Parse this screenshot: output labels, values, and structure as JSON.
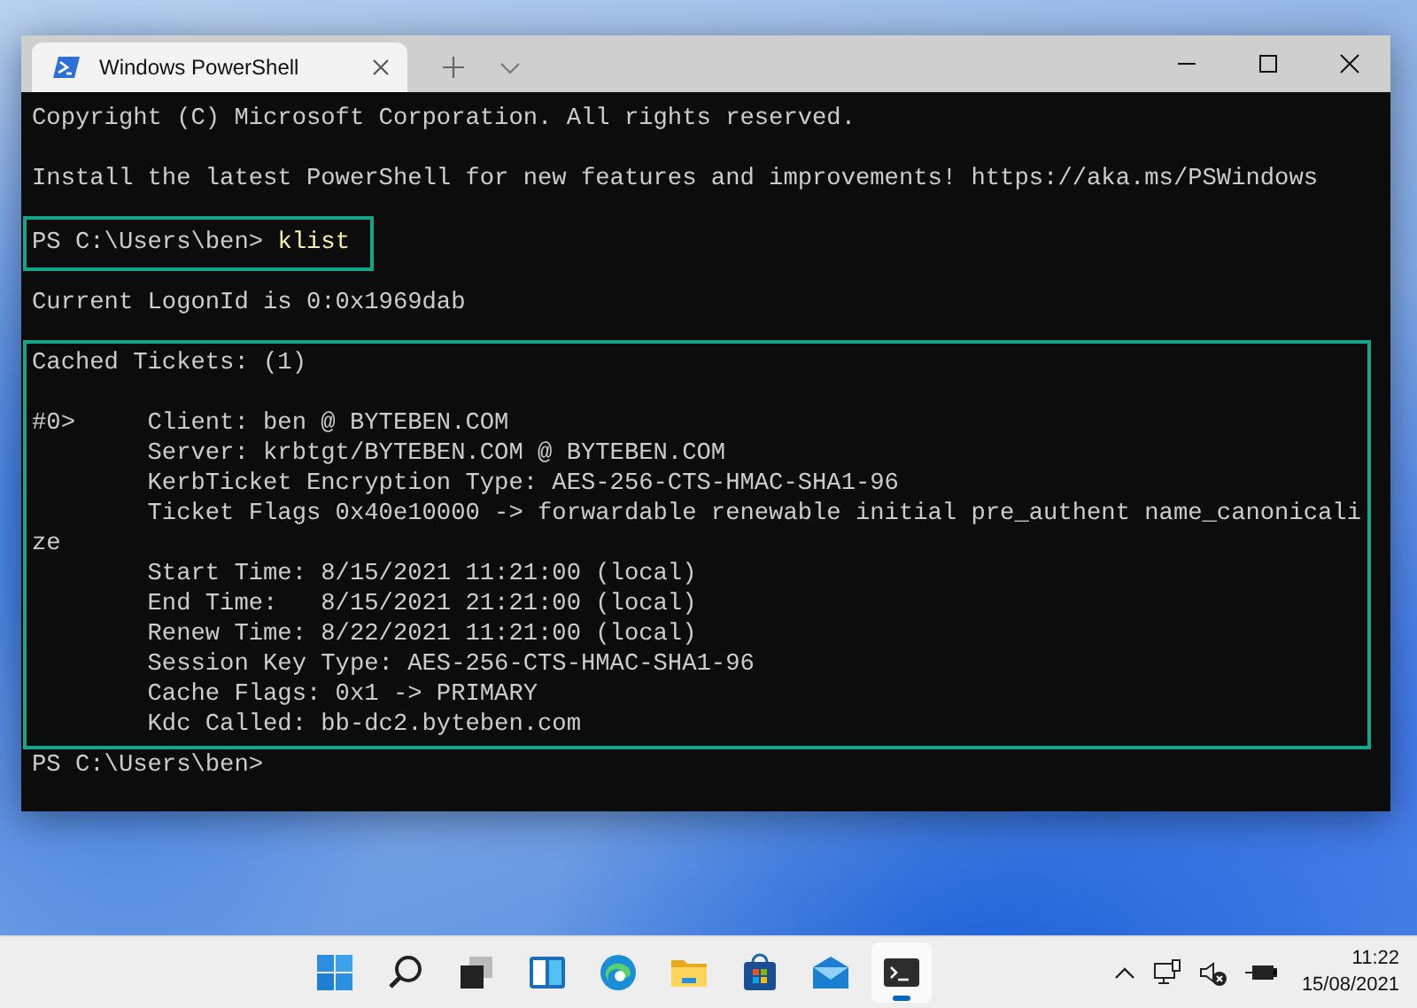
{
  "window": {
    "tabs": [
      {
        "title": "Windows PowerShell",
        "selected": true
      }
    ]
  },
  "terminal": {
    "blocks": [
      {
        "highlighted": false,
        "lines": [
          {
            "kind": "text",
            "text": "Copyright (C) Microsoft Corporation. All rights reserved."
          },
          {
            "kind": "blank"
          },
          {
            "kind": "text",
            "text": "Install the latest PowerShell for new features and improvements! https://aka.ms/PSWindows"
          },
          {
            "kind": "blank"
          }
        ]
      },
      {
        "highlighted": true,
        "lines": [
          {
            "kind": "prompt",
            "prompt": "PS C:\\Users\\ben>",
            "command": "klist"
          }
        ]
      },
      {
        "highlighted": false,
        "lines": [
          {
            "kind": "blank"
          },
          {
            "kind": "text",
            "text": "Current LogonId is 0:0x1969dab"
          },
          {
            "kind": "blank"
          }
        ]
      },
      {
        "highlighted": true,
        "lines": [
          {
            "kind": "text",
            "text": "Cached Tickets: (1)"
          },
          {
            "kind": "blank"
          },
          {
            "kind": "text",
            "text": "#0>     Client: ben @ BYTEBEN.COM"
          },
          {
            "kind": "text",
            "text": "        Server: krbtgt/BYTEBEN.COM @ BYTEBEN.COM"
          },
          {
            "kind": "text",
            "text": "        KerbTicket Encryption Type: AES-256-CTS-HMAC-SHA1-96"
          },
          {
            "kind": "text",
            "text": "        Ticket Flags 0x40e10000 -> forwardable renewable initial pre_authent name_canonicali"
          },
          {
            "kind": "text",
            "text": "ze"
          },
          {
            "kind": "text",
            "text": "        Start Time: 8/15/2021 11:21:00 (local)"
          },
          {
            "kind": "text",
            "text": "        End Time:   8/15/2021 21:21:00 (local)"
          },
          {
            "kind": "text",
            "text": "        Renew Time: 8/22/2021 11:21:00 (local)"
          },
          {
            "kind": "text",
            "text": "        Session Key Type: AES-256-CTS-HMAC-SHA1-96"
          },
          {
            "kind": "text",
            "text": "        Cache Flags: 0x1 -> PRIMARY"
          },
          {
            "kind": "text",
            "text": "        Kdc Called: bb-dc2.byteben.com"
          }
        ]
      },
      {
        "highlighted": false,
        "lines": [
          {
            "kind": "prompt",
            "prompt": "PS C:\\Users\\ben>"
          }
        ]
      }
    ]
  },
  "taskbar": {
    "items": [
      {
        "kind": "start",
        "active": false
      },
      {
        "kind": "search",
        "active": false
      },
      {
        "kind": "taskview",
        "active": false
      },
      {
        "kind": "widgets",
        "active": false
      },
      {
        "kind": "browser",
        "active": false
      },
      {
        "kind": "folder",
        "active": false
      },
      {
        "kind": "store",
        "active": false
      },
      {
        "kind": "mail",
        "active": false
      },
      {
        "kind": "terminal",
        "active": true
      }
    ],
    "clock": {
      "time": "11:22",
      "date": "15/08/2021"
    }
  }
}
